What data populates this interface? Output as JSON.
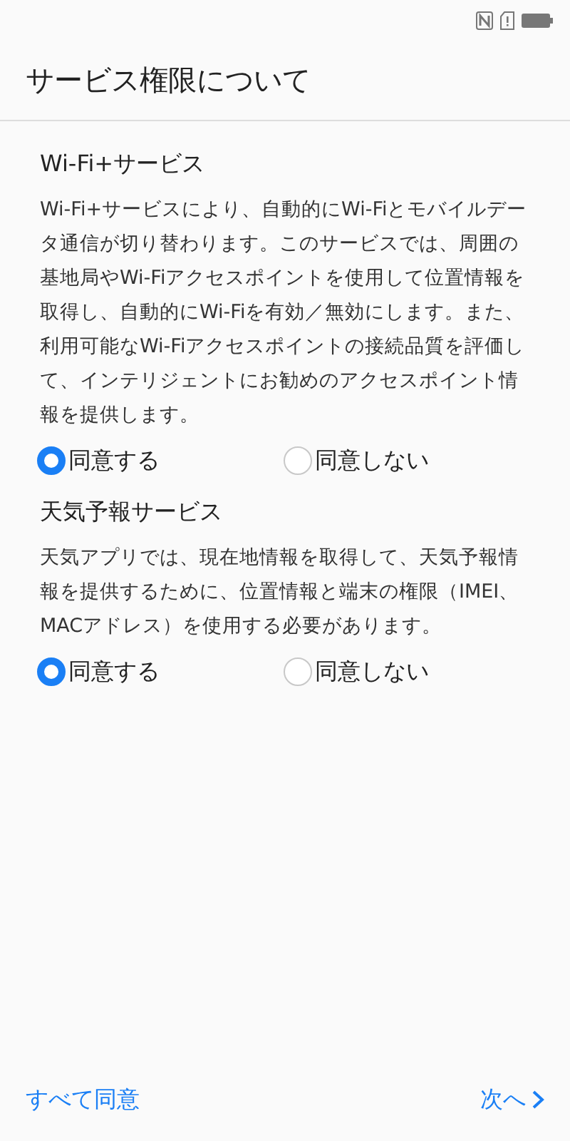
{
  "title": "サービス権限について",
  "sections": [
    {
      "heading": "Wi-Fi+サービス",
      "body": "Wi-Fi+サービスにより、自動的にWi-Fiとモバイルデータ通信が切り替わります。このサービスでは、周囲の基地局やWi-Fiアクセスポイントを使用して位置情報を取得し、自動的にWi-Fiを有効／無効にします。また、利用可能なWi-Fiアクセスポイントの接続品質を評価して、インテリジェントにお勧めのアクセスポイント情報を提供します。",
      "options": [
        {
          "label": "同意する",
          "selected": true
        },
        {
          "label": "同意しない",
          "selected": false
        }
      ]
    },
    {
      "heading": "天気予報サービス",
      "body": "天気アプリでは、現在地情報を取得して、天気予報情報を提供するために、位置情報と端末の権限（IMEI、MACアドレス）を使用する必要があります。",
      "options": [
        {
          "label": "同意する",
          "selected": true
        },
        {
          "label": "同意しない",
          "selected": false
        }
      ]
    }
  ],
  "footer": {
    "agree_all": "すべて同意",
    "next": "次へ"
  }
}
